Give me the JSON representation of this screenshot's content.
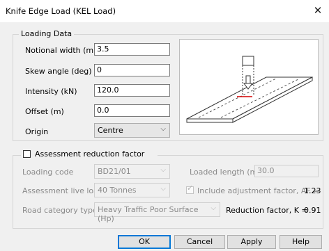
{
  "window": {
    "title": "Knife Edge Load (KEL Load)",
    "close_icon": "close-icon"
  },
  "loading_data": {
    "legend": "Loading Data",
    "notional_width": {
      "label": "Notional width (m)",
      "value": "3.5"
    },
    "skew_angle": {
      "label": "Skew angle (deg)",
      "value": "0"
    },
    "intensity": {
      "label": "Intensity (kN)",
      "value": "120.0"
    },
    "offset": {
      "label": "Offset (m)",
      "value": "0.0"
    },
    "origin": {
      "label": "Origin",
      "value": "Centre"
    }
  },
  "assessment": {
    "checkbox_label": "Assessment reduction factor",
    "checked": false,
    "loading_code": {
      "label": "Loading code",
      "value": "BD21/01"
    },
    "loaded_length": {
      "label": "Loaded length (m)",
      "value": "30.0"
    },
    "assessment_live_load": {
      "label": "Assessment live load",
      "value": "40 Tonnes"
    },
    "include_adjustment": {
      "label": "Include adjustment factor, AF =",
      "value": "1.23",
      "checked": true
    },
    "road_category": {
      "label": "Road category type",
      "value": "Heavy Traffic Poor Surface (Hp)"
    },
    "reduction_factor": {
      "label": "Reduction factor, K =",
      "value": "0.91"
    }
  },
  "buttons": {
    "ok": "OK",
    "cancel": "Cancel",
    "apply": "Apply",
    "help": "Help"
  },
  "colors": {
    "accent": "#0078d7",
    "diagram_highlight": "#d40000"
  }
}
